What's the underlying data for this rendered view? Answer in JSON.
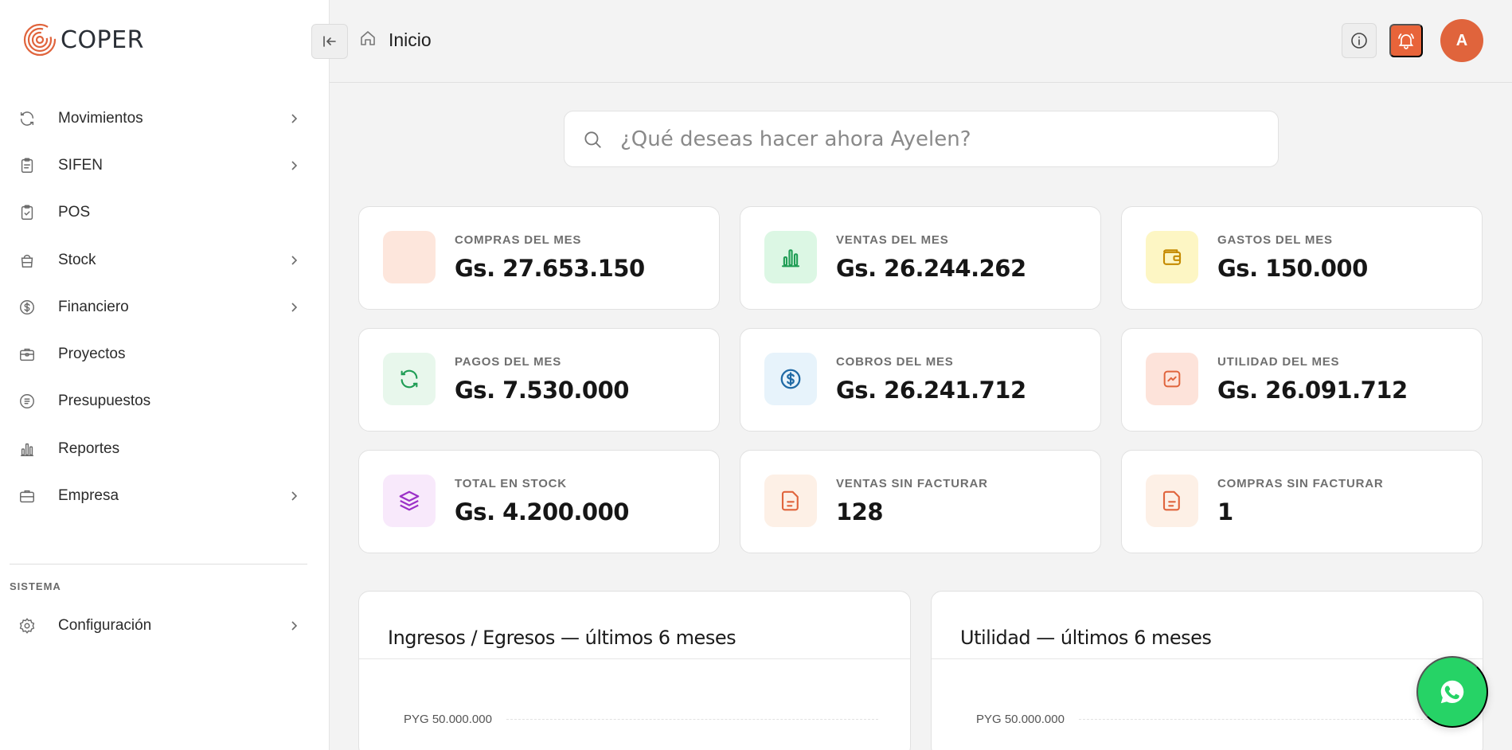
{
  "app": {
    "logo_text": "COPER",
    "brand_color": "#e0643c"
  },
  "sidebar": {
    "items": [
      {
        "label": "Movimientos",
        "icon": "refresh-icon",
        "has_submenu": true
      },
      {
        "label": "SIFEN",
        "icon": "clipboard-list-icon",
        "has_submenu": true
      },
      {
        "label": "POS",
        "icon": "clipboard-check-icon",
        "has_submenu": false
      },
      {
        "label": "Stock",
        "icon": "bag-icon",
        "has_submenu": true
      },
      {
        "label": "Financiero",
        "icon": "dollar-circle-icon",
        "has_submenu": true
      },
      {
        "label": "Proyectos",
        "icon": "briefcase-icon",
        "has_submenu": false
      },
      {
        "label": "Presupuestos",
        "icon": "receipt-icon",
        "has_submenu": false
      },
      {
        "label": "Reportes",
        "icon": "bar-chart-icon",
        "has_submenu": false
      },
      {
        "label": "Empresa",
        "icon": "building-briefcase-icon",
        "has_submenu": true
      }
    ],
    "section_title": "SISTEMA",
    "system_items": [
      {
        "label": "Configuración",
        "icon": "gear-icon",
        "has_submenu": true
      }
    ]
  },
  "header": {
    "breadcrumb": "Inicio",
    "avatar_initial": "A"
  },
  "search": {
    "placeholder": "¿Qué deseas hacer ahora Ayelen?"
  },
  "stats": [
    {
      "label": "COMPRAS DEL MES",
      "value": "Gs. 27.653.150",
      "icon": "cart-icon",
      "bg": "#fde6dc",
      "fg": "#e0643c"
    },
    {
      "label": "VENTAS DEL MES",
      "value": "Gs. 26.244.262",
      "icon": "bar-chart-icon",
      "bg": "#dcf7e4",
      "fg": "#1f9d55"
    },
    {
      "label": "GASTOS DEL MES",
      "value": "Gs. 150.000",
      "icon": "wallet-icon",
      "bg": "#fdf6c4",
      "fg": "#c58a00"
    },
    {
      "label": "PAGOS DEL MES",
      "value": "Gs. 7.530.000",
      "icon": "refresh-icon",
      "bg": "#e8f7ec",
      "fg": "#1f9d55"
    },
    {
      "label": "COBROS DEL MES",
      "value": "Gs. 26.241.712",
      "icon": "dollar-circle-icon",
      "bg": "#e7f3fb",
      "fg": "#1f6aa5"
    },
    {
      "label": "UTILIDAD DEL MES",
      "value": "Gs. 26.091.712",
      "icon": "trend-icon",
      "bg": "#fde3da",
      "fg": "#e0643c"
    },
    {
      "label": "TOTAL EN STOCK",
      "value": "Gs. 4.200.000",
      "icon": "layers-icon",
      "bg": "#f8e9fb",
      "fg": "#9b30c7"
    },
    {
      "label": "VENTAS SIN FACTURAR",
      "value": "128",
      "icon": "file-icon",
      "bg": "#fdf0e6",
      "fg": "#e0643c"
    },
    {
      "label": "COMPRAS SIN FACTURAR",
      "value": "1",
      "icon": "file-icon",
      "bg": "#fdf0e6",
      "fg": "#e0643c"
    }
  ],
  "panels": [
    {
      "title": "Ingresos / Egresos — últimos 6 meses",
      "top_tick": "PYG 50.000.000"
    },
    {
      "title": "Utilidad — últimos 6 meses",
      "top_tick": "PYG 50.000.000"
    }
  ],
  "whatsapp": {
    "icon": "whatsapp-icon",
    "color": "#26d366"
  }
}
